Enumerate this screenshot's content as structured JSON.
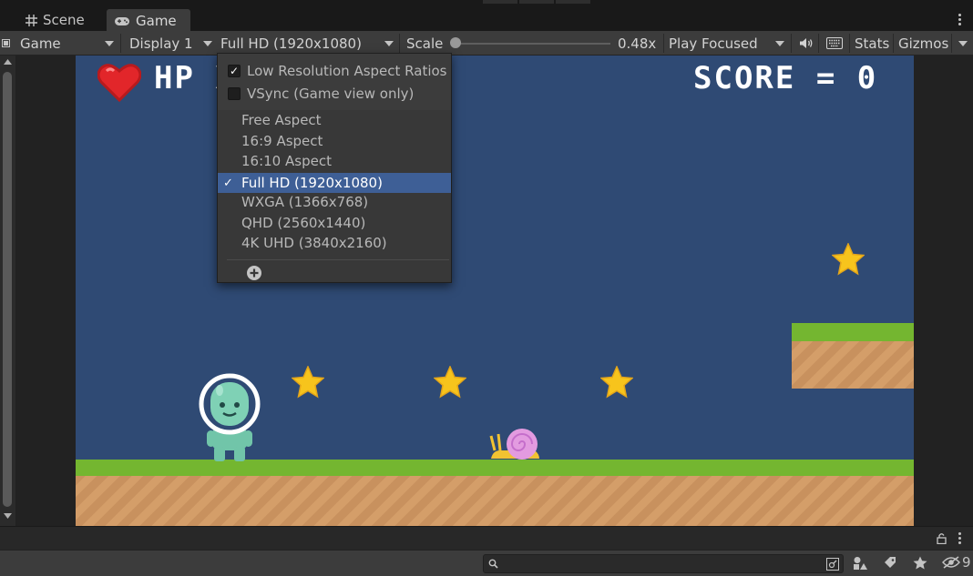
{
  "tabs": [
    {
      "label": "Scene",
      "icon": "grid-icon"
    },
    {
      "label": "Game",
      "icon": "gamepad-icon",
      "active": true
    }
  ],
  "toolbar": {
    "view_mode": "Game",
    "display": "Display 1",
    "resolution": "Full HD (1920x1080)",
    "scale_label": "Scale",
    "scale_value": "0.48x",
    "scale_fraction": 0.0,
    "play_mode": "Play Focused",
    "stats_label": "Stats",
    "gizmos_label": "Gizmos"
  },
  "resolution_menu": {
    "toggles": [
      {
        "label": "Low Resolution Aspect Ratios",
        "checked": true
      },
      {
        "label": "VSync (Game view only)",
        "checked": false
      }
    ],
    "items": [
      {
        "label": "Free Aspect",
        "selected": false
      },
      {
        "label": "16:9 Aspect",
        "selected": false
      },
      {
        "label": "16:10 Aspect",
        "selected": false
      },
      {
        "label": "Full HD (1920x1080)",
        "selected": true
      },
      {
        "label": "WXGA (1366x768)",
        "selected": false
      },
      {
        "label": "QHD (2560x1440)",
        "selected": false
      },
      {
        "label": "4K UHD (3840x2160)",
        "selected": false
      }
    ],
    "selected_mark": "✓",
    "add_icon": "plus-circle-icon"
  },
  "game": {
    "hp_label": "HP X",
    "score_label": "SCORE = 0",
    "colors": {
      "sky": "#2f4a74",
      "grass": "#74b630",
      "dirt": "#c8915e",
      "star": "#f7c41c",
      "heart": "#e2262a"
    }
  },
  "status": {
    "hidden_count": "9"
  },
  "colors": {
    "selection": "#3e5f96",
    "toolbar": "#3c3c3c",
    "background": "#191919"
  }
}
